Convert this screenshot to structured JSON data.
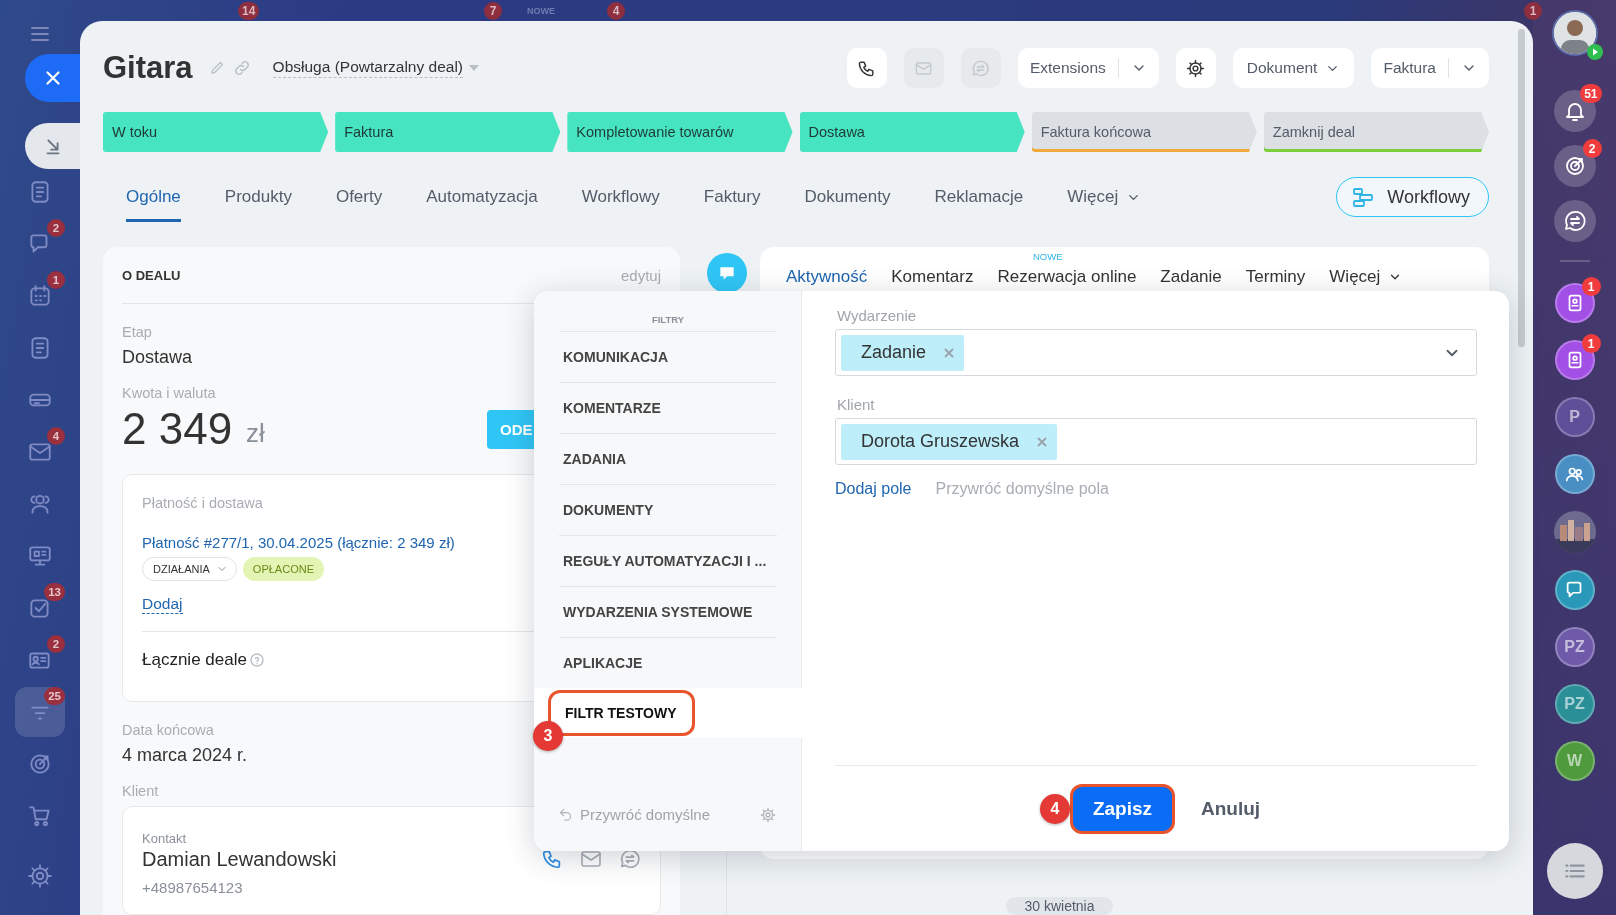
{
  "top_counters": [
    {
      "kind": "badge",
      "text": "14"
    },
    {
      "kind": "badge",
      "text": "7"
    },
    {
      "kind": "label",
      "text": "NOWE"
    },
    {
      "kind": "badge",
      "text": "4"
    },
    {
      "kind": "badge",
      "text": "1"
    }
  ],
  "left_rail": {
    "items": [
      {
        "selected": false
      },
      {
        "selected": false,
        "badge": "2"
      },
      {
        "selected": false,
        "badge": "1"
      },
      {
        "selected": false
      },
      {
        "selected": false
      },
      {
        "selected": false,
        "badge": "4"
      },
      {
        "selected": false
      },
      {
        "selected": false
      },
      {
        "selected": false,
        "badge": "13"
      },
      {
        "selected": false,
        "badge": "2"
      },
      {
        "selected": true,
        "badge": "25"
      },
      {
        "selected": false
      },
      {
        "selected": false
      },
      {
        "selected": false
      }
    ]
  },
  "header": {
    "title": "Gitara",
    "category": "Obsługa (Powtarzalny deal)",
    "actions": [
      {
        "kind": "icon",
        "disabled": false
      },
      {
        "kind": "icon",
        "disabled": true
      },
      {
        "kind": "icon",
        "disabled": true
      },
      {
        "kind": "split",
        "label": "Extensions"
      },
      {
        "kind": "icon",
        "disabled": false
      },
      {
        "kind": "dropdown",
        "label": "Dokument"
      },
      {
        "kind": "split",
        "label": "Faktura"
      }
    ]
  },
  "stages": [
    {
      "label": "W toku",
      "done": true,
      "color": "#47e4c2"
    },
    {
      "label": "Faktura",
      "done": true,
      "color": "#47e4c2"
    },
    {
      "label": "Kompletowanie towarów",
      "done": true,
      "color": "#47e4c2"
    },
    {
      "label": "Dostawa",
      "done": true,
      "color": "#47e4c2"
    },
    {
      "label": "Faktura końcowa",
      "done": false,
      "color": "#f2a93b"
    },
    {
      "label": "Zamknij deal",
      "done": false,
      "color": "#7bd03a"
    }
  ],
  "tabs": [
    {
      "label": "Ogólne",
      "selected": true,
      "kind": "tab"
    },
    {
      "label": "Produkty",
      "selected": false,
      "kind": "tab"
    },
    {
      "label": "Oferty",
      "selected": false,
      "kind": "tab"
    },
    {
      "label": "Automatyzacja",
      "selected": false,
      "kind": "tab"
    },
    {
      "label": "Workflowy",
      "selected": false,
      "kind": "tab"
    },
    {
      "label": "Faktury",
      "selected": false,
      "kind": "tab"
    },
    {
      "label": "Dokumenty",
      "selected": false,
      "kind": "tab"
    },
    {
      "label": "Reklamacje",
      "selected": false,
      "kind": "tab"
    },
    {
      "label": "Więcej",
      "selected": false,
      "kind": "dropdown"
    }
  ],
  "workflow_button": "Workflowy",
  "deal": {
    "title": "O DEALU",
    "edit": "edytuj",
    "stage_label": "Etap",
    "stage": "Dostawa",
    "amount_label": "Kwota i waluta",
    "amount": "2 349",
    "currency": "zł",
    "amount_button": "ODE",
    "payment": {
      "title": "Płatność i dostawa",
      "link": "Płatność #277/1, 30.04.2025 (łącznie: 2 349 zł)",
      "actions": "DZIAŁANIA",
      "status": "OPŁACONE",
      "add": "Dodaj",
      "total": "Łącznie deale"
    },
    "end_date_label": "Data końcowa",
    "end_date": "4 marca 2024 r.",
    "client_label": "Klient",
    "contact": {
      "label": "Kontakt",
      "name": "Damian Lewandowski",
      "phone": "+48987654123"
    }
  },
  "timeline": {
    "tabs": [
      {
        "label": "Aktywność",
        "selected": true,
        "kind": "tab"
      },
      {
        "label": "Komentarz",
        "selected": false,
        "kind": "tab"
      },
      {
        "label": "Rezerwacja online",
        "selected": false,
        "kind": "tab",
        "badge": "NOWE"
      },
      {
        "label": "Zadanie",
        "selected": false,
        "kind": "tab"
      },
      {
        "label": "Terminy",
        "selected": false,
        "kind": "tab"
      },
      {
        "label": "Więcej",
        "selected": false,
        "kind": "dropdown"
      }
    ],
    "date": "30 kwietnia"
  },
  "filter_popup": {
    "filters": {
      "title": "FILTRY",
      "items": [
        {
          "label": "KOMUNIKACJA",
          "selected": false,
          "highlighted": false
        },
        {
          "label": "KOMENTARZE",
          "selected": false,
          "highlighted": false
        },
        {
          "label": "ZADANIA",
          "selected": false,
          "highlighted": false
        },
        {
          "label": "DOKUMENTY",
          "selected": false,
          "highlighted": false
        },
        {
          "label": "REGUŁY AUTOMATYZACJI I ...",
          "selected": false,
          "highlighted": false
        },
        {
          "label": "WYDARZENIA SYSTEMOWE",
          "selected": false,
          "highlighted": false
        },
        {
          "label": "APLIKACJE",
          "selected": false,
          "highlighted": false
        },
        {
          "label": "FILTR TESTOWY",
          "selected": true,
          "highlighted": true,
          "callout": "3"
        }
      ],
      "reset": "Przywróć domyślne"
    },
    "form": {
      "fields": [
        {
          "label": "Wydarzenie",
          "tags": [
            "Zadanie"
          ],
          "dropdown": true
        },
        {
          "label": "Klient",
          "tags": [
            "Dorota Gruszewska"
          ],
          "dropdown": false
        }
      ],
      "add_field": "Dodaj pole",
      "restore_fields": "Przywróć domyślne pola",
      "save": {
        "label": "Zapisz",
        "highlighted": true,
        "callout": "4"
      },
      "cancel": "Anuluj"
    }
  },
  "right_rail": {
    "tools": [
      {
        "kind": "button",
        "badge": "51"
      },
      {
        "kind": "button",
        "badge": "2"
      },
      {
        "kind": "button"
      }
    ],
    "chats": [
      {
        "kind": "icon",
        "color": "#a24fe6",
        "badge": "1"
      },
      {
        "kind": "icon",
        "color": "#a24fe6",
        "badge": "1"
      },
      {
        "kind": "initials",
        "text": "P",
        "color": "#5e4f98"
      },
      {
        "kind": "icon",
        "color": "#4a8fc4"
      },
      {
        "kind": "picture"
      },
      {
        "kind": "icon",
        "color": "#2a98b8"
      },
      {
        "kind": "initials",
        "text": "PZ",
        "color": "#6e5aa8"
      },
      {
        "kind": "initials",
        "text": "PZ",
        "color": "#2b8f98"
      },
      {
        "kind": "initials",
        "text": "W",
        "color": "#4e9a3c"
      }
    ]
  }
}
